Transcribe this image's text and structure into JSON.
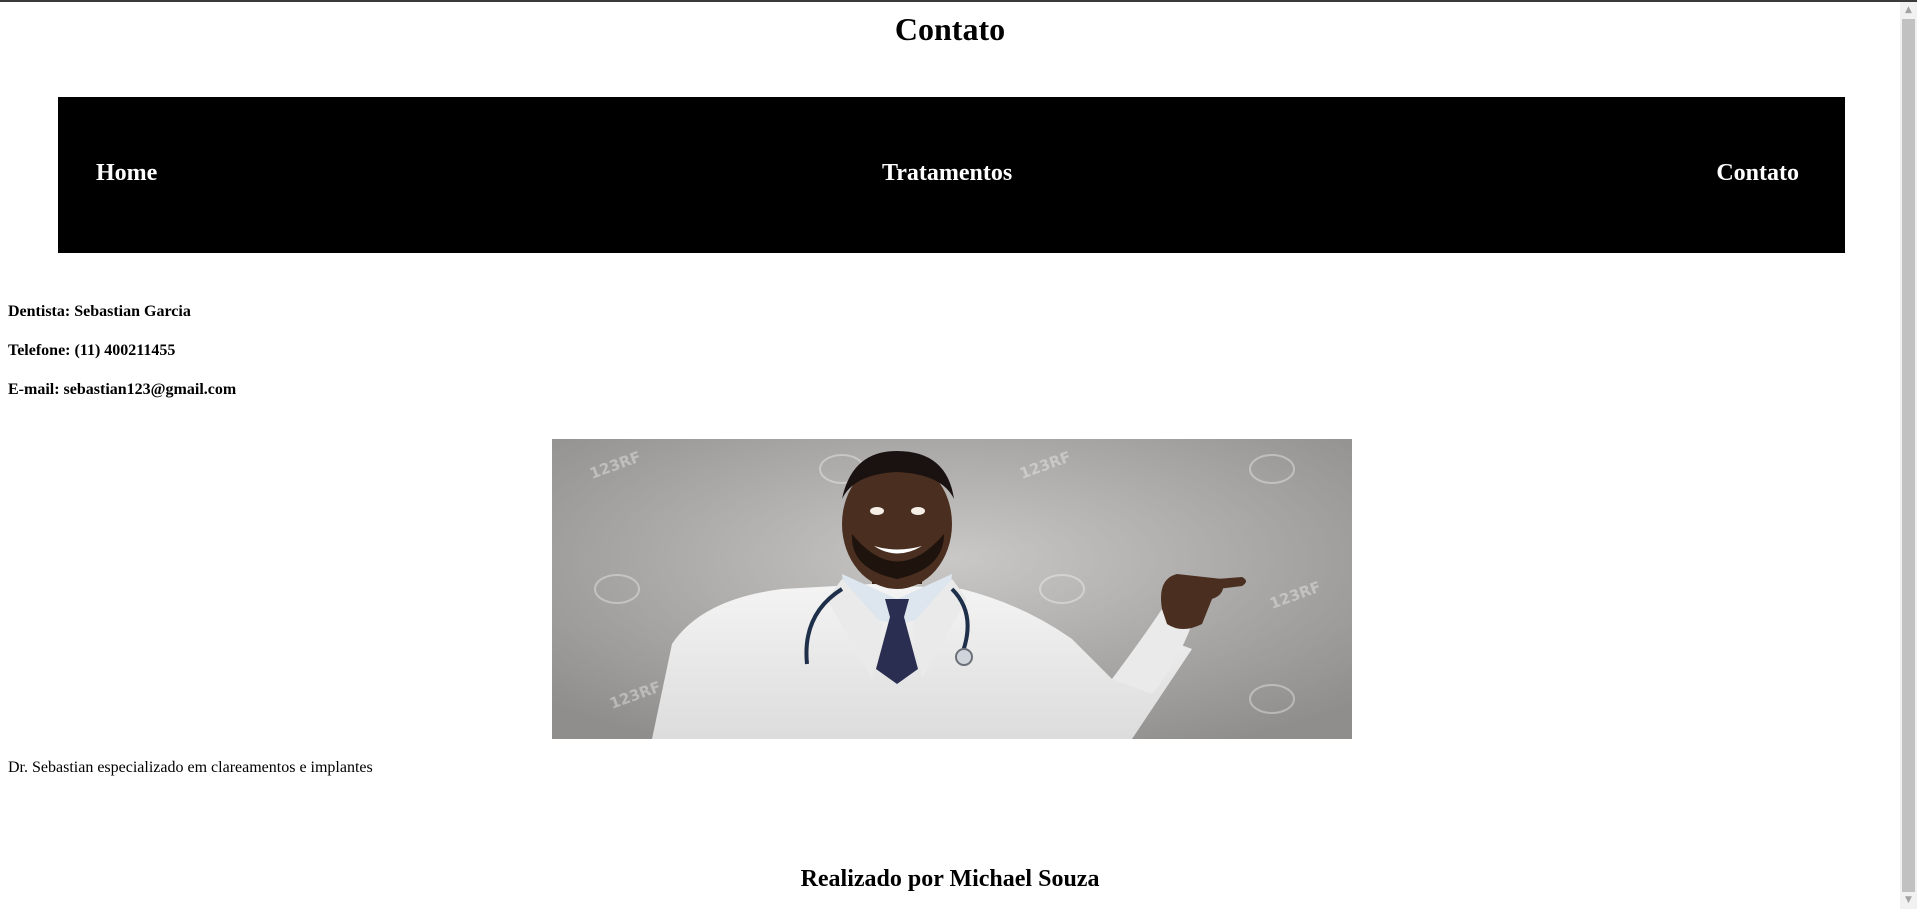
{
  "page": {
    "title": "Contato"
  },
  "nav": {
    "items": [
      "Home",
      "Tratamentos",
      "Contato"
    ]
  },
  "contact": {
    "dentist": "Dentista: Sebastian Garcia",
    "phone": "Telefone: (11) 400211455",
    "email": "E-mail: sebastian123@gmail.com"
  },
  "photo": {
    "watermark": "123RF"
  },
  "caption": "Dr. Sebastian especializado em clareamentos e implantes",
  "footer": "Realizado por Michael Souza",
  "colors": {
    "navbar": "#000000",
    "nav_text": "#ffffff",
    "background": "#ffffff"
  },
  "icons": {
    "scroll_up": "arrow-up-icon",
    "scroll_down": "arrow-down-icon"
  }
}
